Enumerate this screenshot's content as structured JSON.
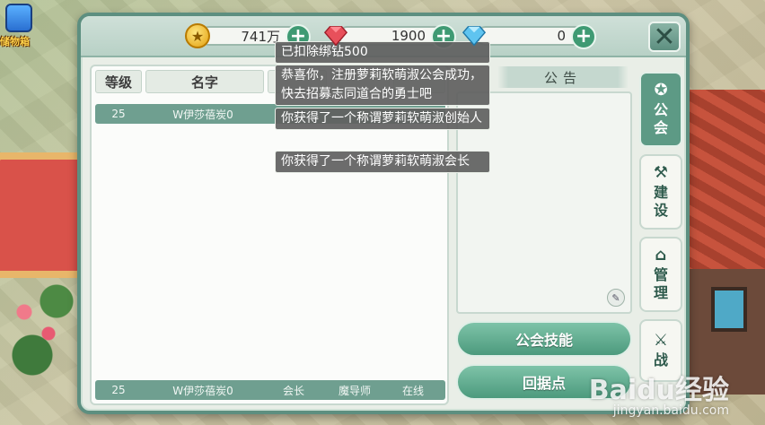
{
  "chest": {
    "label": "储物箱"
  },
  "resources": {
    "gold": {
      "value": "741万",
      "icon": "gold-coin-icon"
    },
    "ruby": {
      "value": "1900",
      "icon": "ruby-icon"
    },
    "diamond": {
      "value": "0",
      "icon": "diamond-icon"
    },
    "plus": "+"
  },
  "close": "✕",
  "members": {
    "headers": [
      "等级",
      "名字",
      "",
      "",
      ""
    ],
    "rows": [
      {
        "level": "25",
        "name": "W伊莎蓓炭0",
        "title": "",
        "job": "",
        "status": ""
      }
    ],
    "footer": {
      "level": "25",
      "name": "W伊莎蓓炭0",
      "title": "会长",
      "job": "魔导师",
      "status": "在线"
    }
  },
  "notice": {
    "title": "公告"
  },
  "buttons": {
    "skills": "公会技能",
    "base": "回据点"
  },
  "tabs": [
    {
      "label1": "公",
      "label2": "会",
      "icon": "guild-icon",
      "active": true
    },
    {
      "label1": "建",
      "label2": "设",
      "icon": "build-icon",
      "active": false
    },
    {
      "label1": "管",
      "label2": "理",
      "icon": "manage-icon",
      "active": false
    },
    {
      "label1": "战",
      "label2": "",
      "icon": "battle-icon",
      "active": false
    }
  ],
  "toasts": [
    "已扣除绑钻500",
    "恭喜你，注册萝莉软萌淑公会成功，快去招募志同道合的勇士吧",
    "你获得了一个称谓萝莉软萌淑创始人",
    "你获得了一个称谓萝莉软萌淑会长"
  ],
  "watermark": {
    "main": "Baidu经验",
    "sub": "jingyan.baidu.com"
  },
  "colors": {
    "accent": "#5d9a85",
    "frame": "#5d8f80",
    "button": "#4c9a7d"
  }
}
